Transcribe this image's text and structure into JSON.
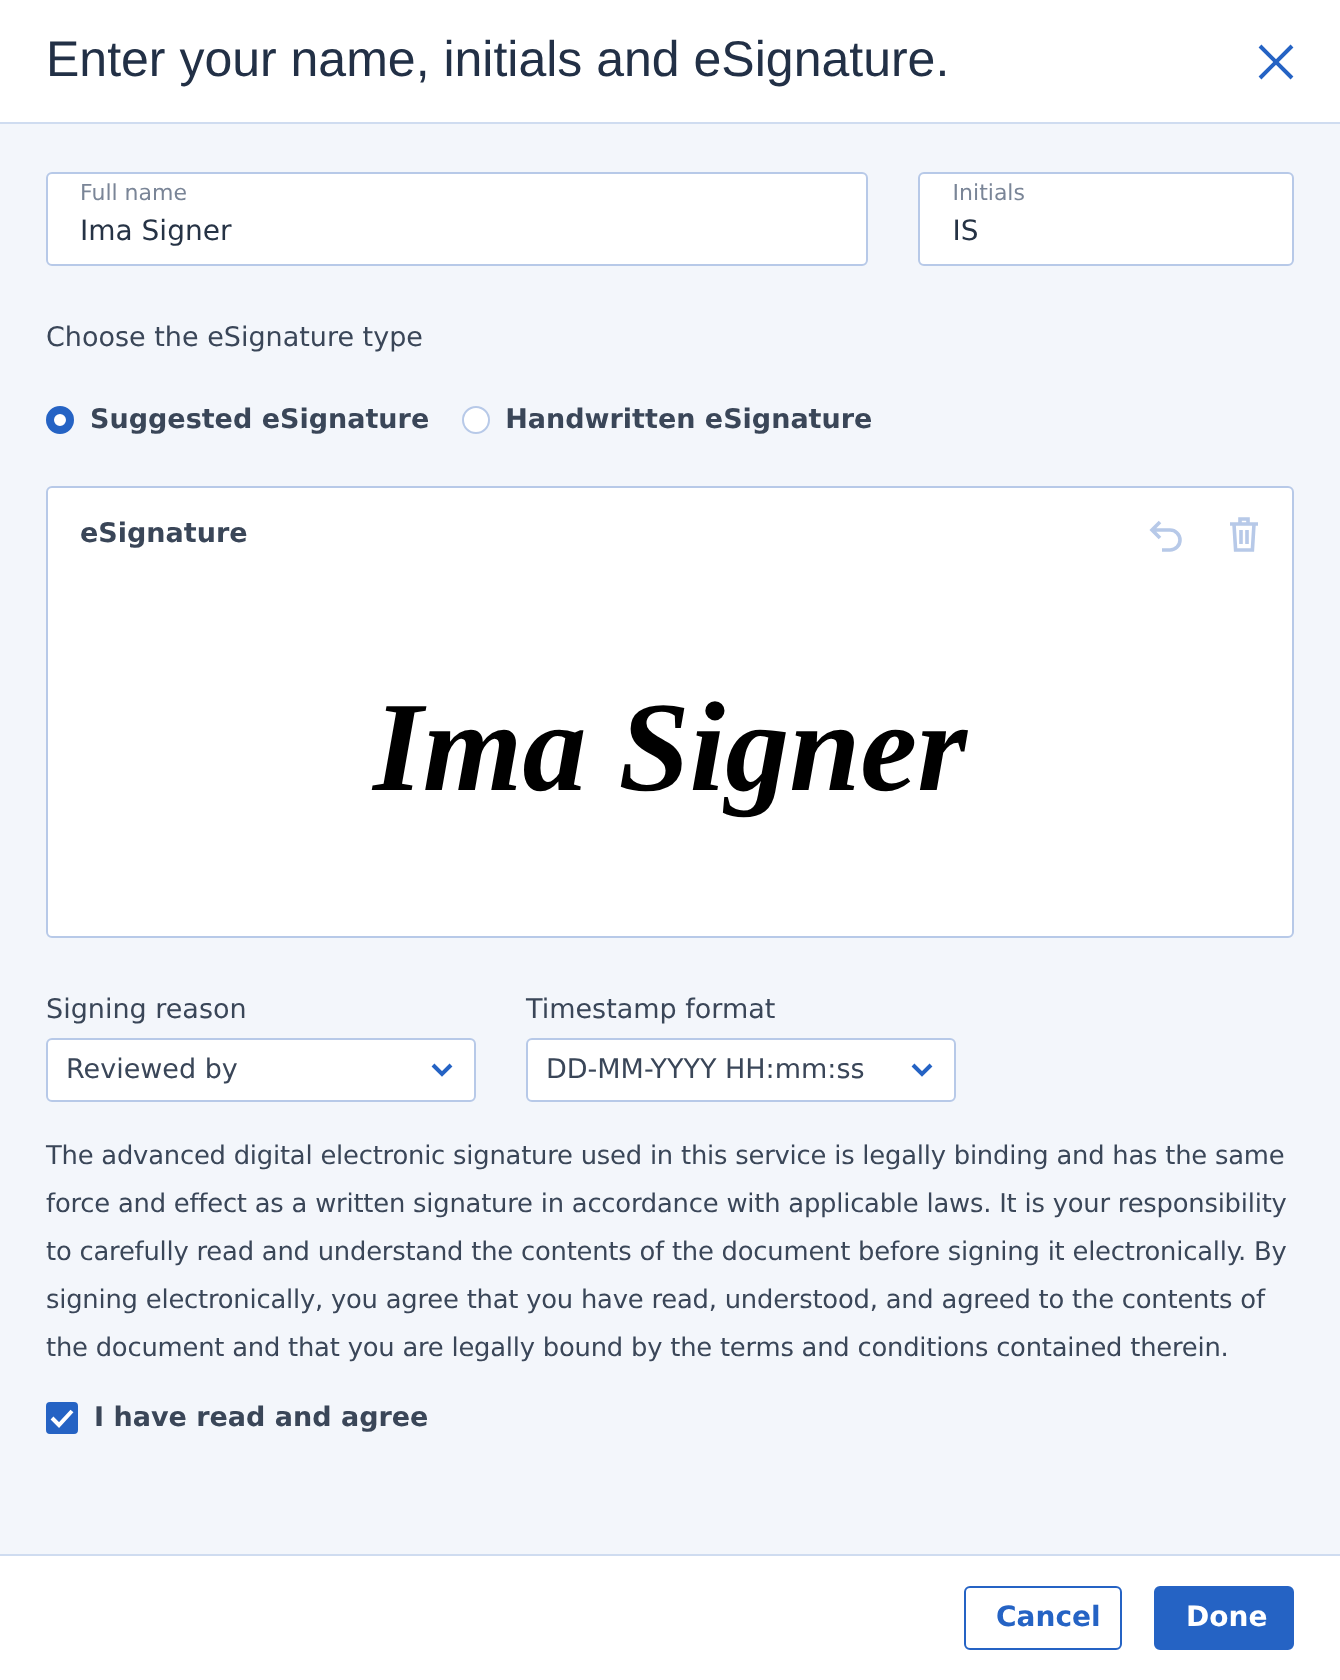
{
  "window": {
    "title": "Enter your name, initials and eSignature."
  },
  "fields": [
    {
      "label": "Full name",
      "value": "Ima Signer",
      "kind": "wide"
    },
    {
      "label": "Initials",
      "value": "IS",
      "kind": "narrow"
    }
  ],
  "signature_type": {
    "label": "Choose the eSignature type",
    "options": [
      {
        "label": "Suggested eSignature",
        "selected": true
      },
      {
        "label": "Handwritten eSignature",
        "selected": false
      }
    ]
  },
  "signature_panel": {
    "title": "eSignature",
    "signature": "Ima Signer"
  },
  "selects": [
    {
      "label": "Signing reason",
      "value": "Reviewed by"
    },
    {
      "label": "Timestamp format",
      "value": "DD-MM-YYYY HH:mm:ss"
    }
  ],
  "legal_text": "The advanced digital electronic signature used in this service is legally binding and has the same force and effect as a written signature in accordance with applicable laws. It is your responsibility to carefully read and understand the contents of the document before signing it electronically. By signing electronically, you agree that you have read, understood, and agreed to the contents of the document and that you are legally bound by the terms and conditions contained therein.",
  "agree": {
    "label": "I have read and agree",
    "checked": true
  },
  "buttons": [
    {
      "label": "Cancel",
      "kind": "secondary"
    },
    {
      "label": "Done",
      "kind": "primary"
    }
  ]
}
